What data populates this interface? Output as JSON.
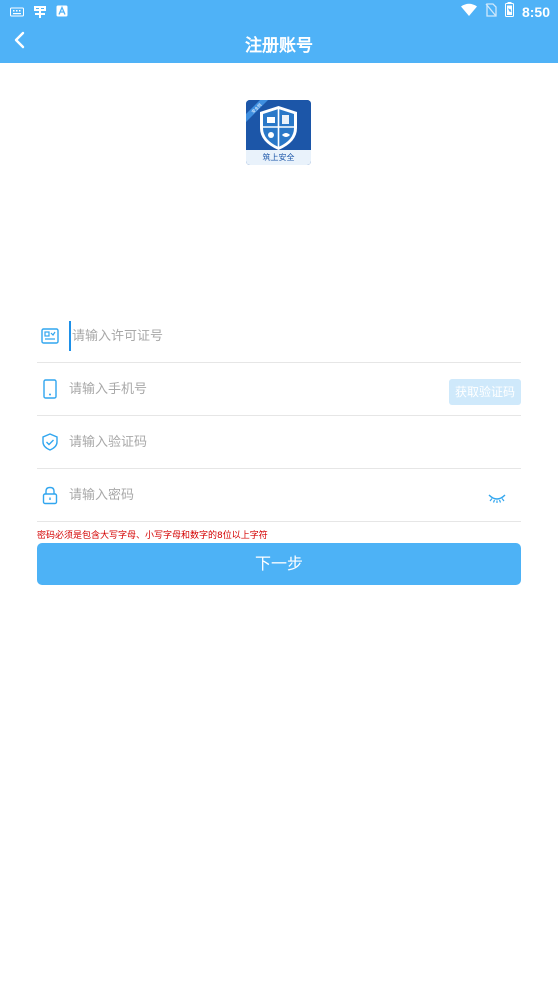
{
  "status_bar": {
    "time": "8:50",
    "icons": [
      "keyboard-icon",
      "debug-icon",
      "a-icon",
      "wifi-icon",
      "no-sim-icon",
      "battery-icon"
    ]
  },
  "app_bar": {
    "title": "注册账号",
    "back_icon": "chevron-left-icon"
  },
  "logo": {
    "label": "筑上安全",
    "badge": "安全网"
  },
  "form": {
    "license": {
      "placeholder": "请输入许可证号",
      "icon": "license-icon"
    },
    "phone": {
      "placeholder": "请输入手机号",
      "icon": "phone-icon",
      "code_button": "获取验证码"
    },
    "code": {
      "placeholder": "请输入验证码",
      "icon": "shield-check-icon"
    },
    "password": {
      "placeholder": "请输入密码",
      "icon": "lock-icon",
      "toggle_icon": "eye-closed-icon"
    },
    "hint": "密码必须是包含大写字母、小写字母和数字的8位以上字符"
  },
  "next_button": "下一步",
  "colors": {
    "primary": "#4fb2f7",
    "hint": "#d40000",
    "disabled_button": "#cfe9fb",
    "icon": "#31a6ef"
  }
}
